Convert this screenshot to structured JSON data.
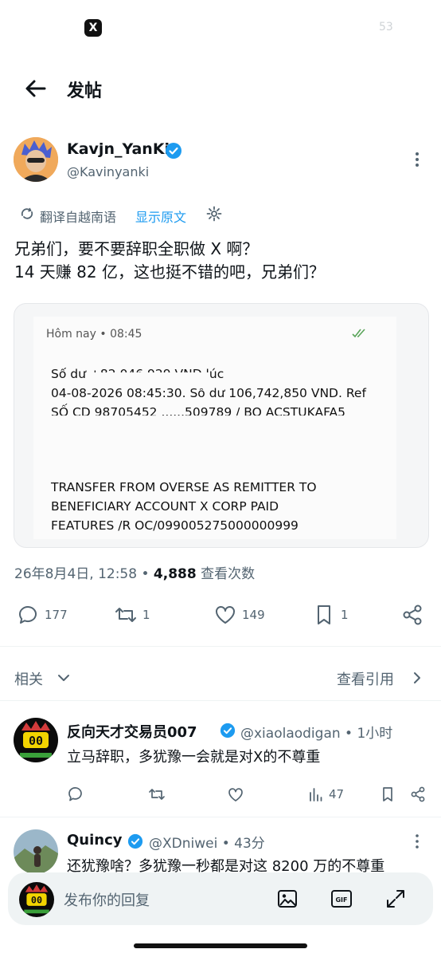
{
  "status_bar": {
    "app_badge": "X",
    "number": "53"
  },
  "header": {
    "title": "发帖"
  },
  "post": {
    "author_name": "Kavjn_YanKi",
    "handle": "@Kavinyanki",
    "translate_label": "翻译自越南语",
    "show_original": "显示原文",
    "text": "兄弟们，要不要辞职全职做 X 啊？\n14 天赚 82 亿，这也挺不错的吧，兄弟们？",
    "media": {
      "sms_header": "Hôm nay • 08:45",
      "sms_body_1": "Số dư                          +82,046,929 VND lúc\n04-08-2026 08:45:30. Số dư 106,742,850 VND. Ref\nSỐ CD 98705452 ......509789 / BO ACSTUKAFA5",
      "sms_body_2": "TRANSFER FROM OVERSE AS REMITTER TO\nBENEFICIARY ACCOUNT X CORP PAID\nFEATURES /R OC/099005275000000999"
    },
    "timestamp": "26年8月4日, 12:58 • ",
    "views_count": "4,888",
    "views_label": " 查看次数",
    "replies": "177",
    "reposts": "1",
    "likes": "149",
    "bookmarks": "1"
  },
  "related": {
    "label": "相关",
    "quotes_label": "查看引用"
  },
  "replies": [
    {
      "name": "反向天才交易员007",
      "handle": "@xiaolaodigan • 1小时",
      "text": "立马辞职，多犹豫一会就是对X的不尊重",
      "views": "47"
    },
    {
      "name": "Quincy",
      "handle": "@XDniwei • 43分",
      "text": "还犹豫啥？多犹豫一秒都是对这 8200 万的不尊重"
    }
  ],
  "composer": {
    "placeholder": "发布你的回复"
  },
  "colors": {
    "accent": "#1d9bf0",
    "secondary_text": "#536471",
    "verified": "#1d9bf0"
  }
}
